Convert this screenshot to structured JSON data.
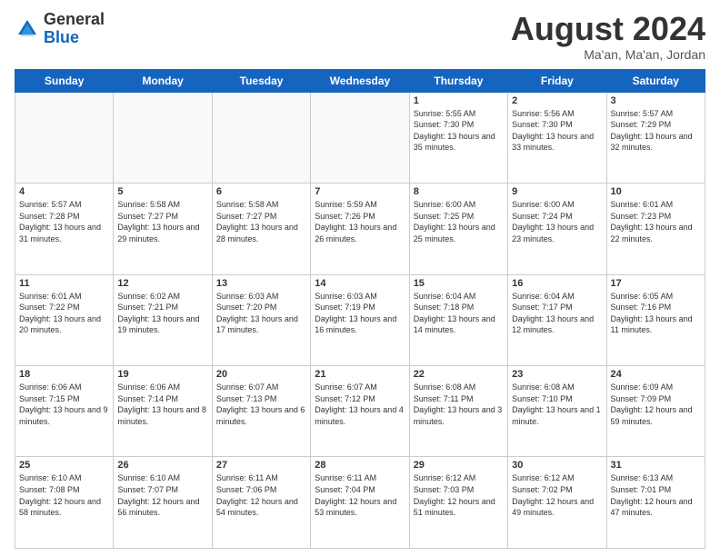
{
  "logo": {
    "general": "General",
    "blue": "Blue"
  },
  "header": {
    "month": "August 2024",
    "location": "Ma'an, Ma'an, Jordan"
  },
  "weekdays": [
    "Sunday",
    "Monday",
    "Tuesday",
    "Wednesday",
    "Thursday",
    "Friday",
    "Saturday"
  ],
  "weeks": [
    [
      {
        "day": "",
        "empty": true
      },
      {
        "day": "",
        "empty": true
      },
      {
        "day": "",
        "empty": true
      },
      {
        "day": "",
        "empty": true
      },
      {
        "day": "1",
        "sunrise": "5:55 AM",
        "sunset": "7:30 PM",
        "daylight": "13 hours and 35 minutes."
      },
      {
        "day": "2",
        "sunrise": "5:56 AM",
        "sunset": "7:30 PM",
        "daylight": "13 hours and 33 minutes."
      },
      {
        "day": "3",
        "sunrise": "5:57 AM",
        "sunset": "7:29 PM",
        "daylight": "13 hours and 32 minutes."
      }
    ],
    [
      {
        "day": "4",
        "sunrise": "5:57 AM",
        "sunset": "7:28 PM",
        "daylight": "13 hours and 31 minutes."
      },
      {
        "day": "5",
        "sunrise": "5:58 AM",
        "sunset": "7:27 PM",
        "daylight": "13 hours and 29 minutes."
      },
      {
        "day": "6",
        "sunrise": "5:58 AM",
        "sunset": "7:27 PM",
        "daylight": "13 hours and 28 minutes."
      },
      {
        "day": "7",
        "sunrise": "5:59 AM",
        "sunset": "7:26 PM",
        "daylight": "13 hours and 26 minutes."
      },
      {
        "day": "8",
        "sunrise": "6:00 AM",
        "sunset": "7:25 PM",
        "daylight": "13 hours and 25 minutes."
      },
      {
        "day": "9",
        "sunrise": "6:00 AM",
        "sunset": "7:24 PM",
        "daylight": "13 hours and 23 minutes."
      },
      {
        "day": "10",
        "sunrise": "6:01 AM",
        "sunset": "7:23 PM",
        "daylight": "13 hours and 22 minutes."
      }
    ],
    [
      {
        "day": "11",
        "sunrise": "6:01 AM",
        "sunset": "7:22 PM",
        "daylight": "13 hours and 20 minutes."
      },
      {
        "day": "12",
        "sunrise": "6:02 AM",
        "sunset": "7:21 PM",
        "daylight": "13 hours and 19 minutes."
      },
      {
        "day": "13",
        "sunrise": "6:03 AM",
        "sunset": "7:20 PM",
        "daylight": "13 hours and 17 minutes."
      },
      {
        "day": "14",
        "sunrise": "6:03 AM",
        "sunset": "7:19 PM",
        "daylight": "13 hours and 16 minutes."
      },
      {
        "day": "15",
        "sunrise": "6:04 AM",
        "sunset": "7:18 PM",
        "daylight": "13 hours and 14 minutes."
      },
      {
        "day": "16",
        "sunrise": "6:04 AM",
        "sunset": "7:17 PM",
        "daylight": "13 hours and 12 minutes."
      },
      {
        "day": "17",
        "sunrise": "6:05 AM",
        "sunset": "7:16 PM",
        "daylight": "13 hours and 11 minutes."
      }
    ],
    [
      {
        "day": "18",
        "sunrise": "6:06 AM",
        "sunset": "7:15 PM",
        "daylight": "13 hours and 9 minutes."
      },
      {
        "day": "19",
        "sunrise": "6:06 AM",
        "sunset": "7:14 PM",
        "daylight": "13 hours and 8 minutes."
      },
      {
        "day": "20",
        "sunrise": "6:07 AM",
        "sunset": "7:13 PM",
        "daylight": "13 hours and 6 minutes."
      },
      {
        "day": "21",
        "sunrise": "6:07 AM",
        "sunset": "7:12 PM",
        "daylight": "13 hours and 4 minutes."
      },
      {
        "day": "22",
        "sunrise": "6:08 AM",
        "sunset": "7:11 PM",
        "daylight": "13 hours and 3 minutes."
      },
      {
        "day": "23",
        "sunrise": "6:08 AM",
        "sunset": "7:10 PM",
        "daylight": "13 hours and 1 minute."
      },
      {
        "day": "24",
        "sunrise": "6:09 AM",
        "sunset": "7:09 PM",
        "daylight": "12 hours and 59 minutes."
      }
    ],
    [
      {
        "day": "25",
        "sunrise": "6:10 AM",
        "sunset": "7:08 PM",
        "daylight": "12 hours and 58 minutes."
      },
      {
        "day": "26",
        "sunrise": "6:10 AM",
        "sunset": "7:07 PM",
        "daylight": "12 hours and 56 minutes."
      },
      {
        "day": "27",
        "sunrise": "6:11 AM",
        "sunset": "7:06 PM",
        "daylight": "12 hours and 54 minutes."
      },
      {
        "day": "28",
        "sunrise": "6:11 AM",
        "sunset": "7:04 PM",
        "daylight": "12 hours and 53 minutes."
      },
      {
        "day": "29",
        "sunrise": "6:12 AM",
        "sunset": "7:03 PM",
        "daylight": "12 hours and 51 minutes."
      },
      {
        "day": "30",
        "sunrise": "6:12 AM",
        "sunset": "7:02 PM",
        "daylight": "12 hours and 49 minutes."
      },
      {
        "day": "31",
        "sunrise": "6:13 AM",
        "sunset": "7:01 PM",
        "daylight": "12 hours and 47 minutes."
      }
    ]
  ]
}
